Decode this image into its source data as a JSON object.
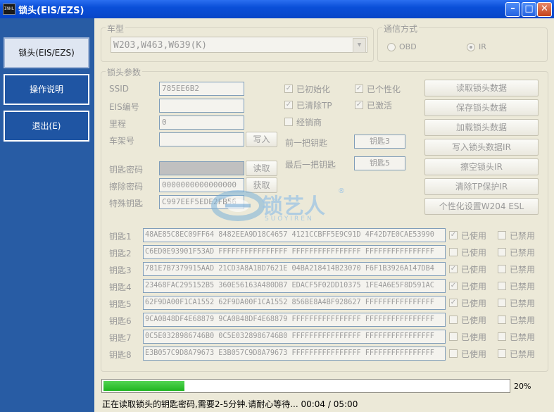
{
  "window": {
    "title": "锁头(EIS/EZS)",
    "icon_text": "INHL"
  },
  "sidebar": {
    "items": [
      {
        "label": "锁头(EIS/EZS)",
        "active": true
      },
      {
        "label": "操作说明",
        "active": false
      },
      {
        "label": "退出(E)",
        "active": false
      }
    ]
  },
  "vehicle": {
    "group_label": "车型",
    "selected": "W203,W463,W639(K)"
  },
  "comm": {
    "group_label": "通信方式",
    "options": [
      "OBD",
      "IR"
    ],
    "selected": "IR"
  },
  "params": {
    "group_label": "锁头参数",
    "ssid_label": "SSID",
    "ssid_value": "785EE6B2",
    "eis_label": "EIS编号",
    "eis_value": "",
    "mileage_label": "里程",
    "mileage_value": "0",
    "vin_label": "车架号",
    "vin_value": "",
    "write_button": "写入",
    "key_password_label": "钥匙密码",
    "key_password_value": "",
    "read_button": "读取",
    "erase_password_label": "擦除密码",
    "erase_password_value": "0000000000000000",
    "get_button": "获取",
    "special_key_label": "特殊钥匙",
    "special_key_value": "C997EEF5EDE2FB56",
    "checks": [
      {
        "label": "已初始化",
        "checked": true
      },
      {
        "label": "已个性化",
        "checked": true
      },
      {
        "label": "已清除TP",
        "checked": true
      },
      {
        "label": "已激活",
        "checked": true
      },
      {
        "label": "经销商",
        "checked": false
      }
    ],
    "prev_key_label": "前一把钥匙",
    "prev_key_value": "钥匙3",
    "last_key_label": "最后一把钥匙",
    "last_key_value": "钥匙5"
  },
  "actions": [
    "读取锁头数据",
    "保存锁头数据",
    "加载锁头数据",
    "写入锁头数据IR",
    "擦空锁头IR",
    "清除TP保护IR",
    "个性化设置W204 ESL"
  ],
  "keys": {
    "used_label": "已使用",
    "disabled_label": "已禁用",
    "rows": [
      {
        "label": "钥匙1",
        "value": "48AE85C8EC09FF64  8482EEA9D18C4657  4121CCBFF5E9C91D  4F42D7E0CAE53990",
        "used": true,
        "disabled": false
      },
      {
        "label": "钥匙2",
        "value": "C6ED0E93901F53AD  FFFFFFFFFFFFFFFF  FFFFFFFFFFFFFFFF  FFFFFFFFFFFFFFFF",
        "used": false,
        "disabled": false
      },
      {
        "label": "钥匙3",
        "value": "781E7B7379915AAD  21CD3A8A1BD7621E  04BA218414B23070  F6F1B3926A147DB4",
        "used": true,
        "disabled": false
      },
      {
        "label": "钥匙4",
        "value": "23468FAC295152B5  360E56163A480DB7  EDACF5F02DD10375  1FE4A6E5F8D591AC",
        "used": true,
        "disabled": false
      },
      {
        "label": "钥匙5",
        "value": "62F9DA00F1CA1552  62F9DA00F1CA1552  856BE8A4BF928627  FFFFFFFFFFFFFFFF",
        "used": true,
        "disabled": false
      },
      {
        "label": "钥匙6",
        "value": "9CA0B48DF4E68879  9CA0B48DF4E68879  FFFFFFFFFFFFFFFF  FFFFFFFFFFFFFFFF",
        "used": false,
        "disabled": false
      },
      {
        "label": "钥匙7",
        "value": "0C5E0328986746B0  0C5E0328986746B0  FFFFFFFFFFFFFFFF  FFFFFFFFFFFFFFFF",
        "used": false,
        "disabled": false
      },
      {
        "label": "钥匙8",
        "value": "E3B057C9D8A79673  E3B057C9D8A79673  FFFFFFFFFFFFFFFF  FFFFFFFFFFFFFFFF",
        "used": false,
        "disabled": false
      }
    ]
  },
  "watermark": {
    "text": "锁艺人",
    "subtext": "SUOYIREN",
    "registered": "®"
  },
  "progress": {
    "percent": 20,
    "percent_label": "20%",
    "status": "正在读取锁头的钥匙密码,需要2-5分钟.请耐心等待...  00:04 / 05:00"
  },
  "colors": {
    "sidebar": "#285ca4",
    "progress": "#1fb51f",
    "titlebar": "#0a4fd8"
  }
}
